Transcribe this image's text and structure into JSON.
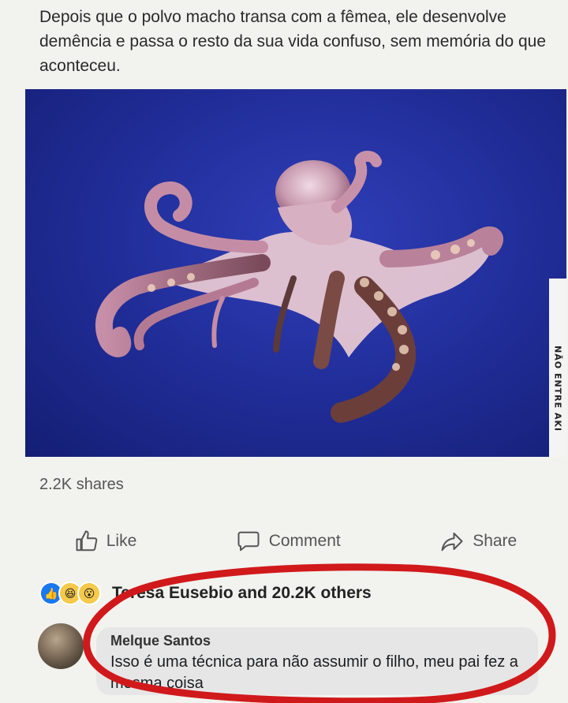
{
  "post": {
    "text": "Depois que o polvo macho transa com a fêmea, ele desenvolve demência e passa o resto da sua vida confuso, sem memória do que aconteceu.",
    "watermark": "NÃO ENTRE AKI",
    "shares": "2.2K shares"
  },
  "actions": {
    "like": "Like",
    "comment": "Comment",
    "share": "Share"
  },
  "reactions": {
    "icons": [
      "like-icon",
      "haha-icon",
      "wow-icon"
    ],
    "summary": "Teresa Eusebio and 20.2K others"
  },
  "comment": {
    "author": "Melque Santos",
    "text": "Isso é uma técnica para não assumir o filho, meu pai fez a mesma coisa"
  },
  "colors": {
    "photo_background": "#222f9c",
    "highlight_circle": "#d0191b",
    "like_blue": "#1877f2"
  }
}
